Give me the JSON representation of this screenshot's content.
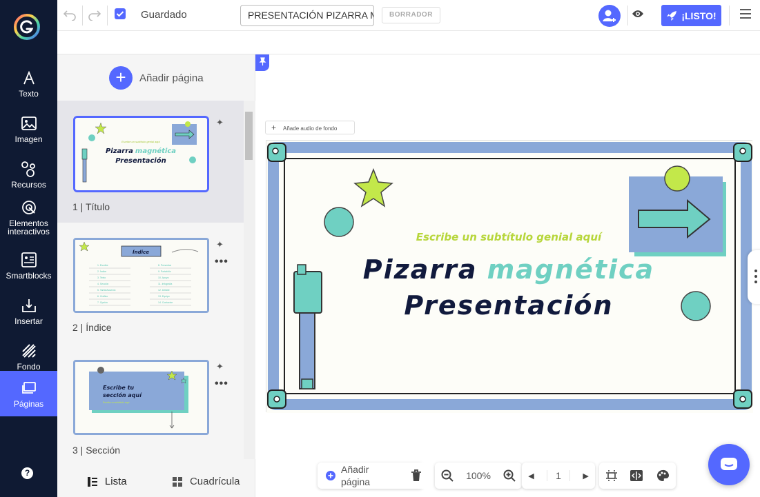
{
  "sidebar": {
    "items": [
      {
        "label": "Texto",
        "icon": "text-icon"
      },
      {
        "label": "Imagen",
        "icon": "image-icon"
      },
      {
        "label": "Recursos",
        "icon": "resources-icon"
      },
      {
        "label": "Elementos interactivos",
        "icon": "interactive-icon"
      },
      {
        "label": "Smartblocks",
        "icon": "smartblocks-icon"
      },
      {
        "label": "Insertar",
        "icon": "insert-icon"
      },
      {
        "label": "Fondo",
        "icon": "background-icon"
      },
      {
        "label": "Páginas",
        "icon": "pages-icon",
        "active": true
      }
    ],
    "help_label": "?"
  },
  "topbar": {
    "saved_label": "Guardado",
    "title_value": "PRESENTACIÓN PIZARRA M",
    "draft_label": "BORRADOR",
    "ready_label": "¡LISTO!"
  },
  "pages_panel": {
    "add_page_label": "Añadir página",
    "pages": [
      {
        "number": "1",
        "label": "Título"
      },
      {
        "number": "2",
        "label": "Índice"
      },
      {
        "number": "3",
        "label": "Sección"
      }
    ],
    "view_list_label": "Lista",
    "view_grid_label": "Cuadrícula"
  },
  "thumbnails": {
    "page1": {
      "subtitle": "Escribe un subtítulo genial aquí",
      "title_a": "Pizarra",
      "title_b": "magnética",
      "title_c": "Presentación"
    },
    "page2": {
      "title": "Índice",
      "left_col": [
        "1. Escribe",
        "2. Índice",
        "3. Texto",
        "4. Sección",
        "5. Tarifa/Acuerdo",
        "6. Gráfico",
        "7. Opción"
      ],
      "right_col": [
        "8. Presentar",
        "9. Portafolio",
        "10. Apoyo",
        "11. Infografía",
        "12. Detalle",
        "13. Equipo",
        "14. Contactar"
      ]
    },
    "page3": {
      "title_line1": "Escribe tu",
      "title_line2": "sección aquí",
      "sub": "Escribe un subtítulo aquí"
    }
  },
  "canvas": {
    "audio_label": "Añade audio de fondo",
    "slide": {
      "subtitle": "Escribe un subtítulo genial aquí",
      "title_word1": "Pizarra",
      "title_word2": "magnética",
      "title_line2": "Presentación"
    }
  },
  "bottom_toolbar": {
    "add_page_line1": "Añadir",
    "add_page_line2": "página",
    "zoom": "100%",
    "page_number": "1"
  },
  "colors": {
    "accent": "#5468ff",
    "sidebar_bg": "#0f1a33",
    "board_frame": "#8aa8d8",
    "teal": "#6fd0c2",
    "lime": "#c3e84a",
    "navy_text": "#111a3d"
  }
}
